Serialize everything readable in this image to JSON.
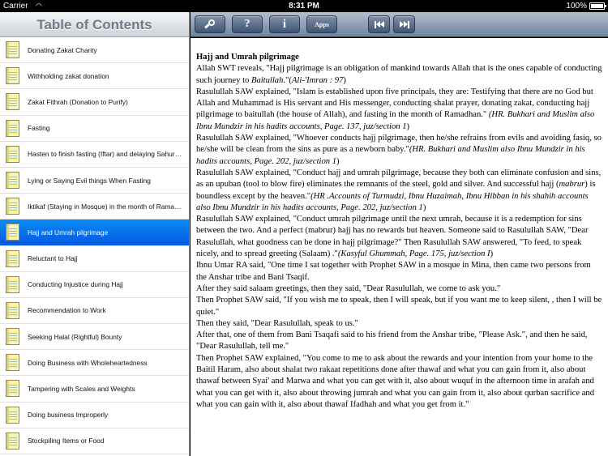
{
  "status_bar": {
    "carrier": "Carrier",
    "time": "8:31 PM",
    "battery": "100%"
  },
  "sidebar": {
    "title": "Table of Contents",
    "items": [
      {
        "label": "Donating Zakat Charity",
        "selected": false
      },
      {
        "label": "Withholding zakat donation",
        "selected": false
      },
      {
        "label": "Zakat Fithrah (Donation to Purify)",
        "selected": false
      },
      {
        "label": "Fasting",
        "selected": false
      },
      {
        "label": "Hasten to finish fasting (Iftar) and delaying Sahur (e...",
        "selected": false
      },
      {
        "label": "Lying or Saying Evil things When Fasting",
        "selected": false
      },
      {
        "label": "Iktikaf (Staying in Mosque) in the month of Ramadh...",
        "selected": false
      },
      {
        "label": "Hajj and Umrah pilgrimage",
        "selected": true
      },
      {
        "label": "Reluctant to Hajj",
        "selected": false
      },
      {
        "label": "Conducting Injustice during Hajj",
        "selected": false
      },
      {
        "label": "Recommendation to Work",
        "selected": false
      },
      {
        "label": "Seeking Halal (Rightful) Bounty",
        "selected": false
      },
      {
        "label": "Doing Business with Wholeheartedness",
        "selected": false
      },
      {
        "label": "Tampering with Scales and Weights",
        "selected": false
      },
      {
        "label": "Doing business Improperly",
        "selected": false
      },
      {
        "label": "Stockpiling Items or Food",
        "selected": false
      }
    ]
  },
  "toolbar": {
    "search_icon": "magnifier-icon",
    "help_label": "?",
    "info_label": "i",
    "apps_label": "Apps",
    "prev_icon": "skip-back-icon",
    "next_icon": "skip-forward-icon"
  },
  "content": {
    "title": "Hajj and Umrah pilgrimage",
    "paragraphs": [
      [
        {
          "t": "Allah SWT reveals, \"Hajj pilgrimage is an obligation of mankind towards Allah that is the ones capable of conducting such journey to "
        },
        {
          "t": "Baitullah",
          "i": true
        },
        {
          "t": ".\"("
        },
        {
          "t": "Ali-'Imran : 97",
          "i": true
        },
        {
          "t": ")"
        }
      ],
      [
        {
          "t": "Rasulullah SAW explained, \"Islam is established upon five principals, they are: Testifying that there are no God but Allah and Muhammad is His servant and  His messenger, conducting shalat prayer, donating zakat, conducting hajj pilgrimage to baitullah (the house of Allah), and fasting in the month of Ramadhan.\" "
        },
        {
          "t": "(HR. Bukhari and Muslim also Ibnu Mundzir in his hadits accounts, Page. 137, juz/section 1",
          "i": true
        },
        {
          "t": ")"
        }
      ],
      [
        {
          "t": "Rasulullah SAW explained, \"Whoever conducts hajj pilgrimage, then he/she refrains from evils and avoiding fasiq, so he/she will be clean from the sins as pure as a newborn baby.\""
        },
        {
          "t": "(HR. Bukhari and Muslim also Ibnu Mundzir in his hadits accounts, Page. 202, juz/section 1",
          "i": true
        },
        {
          "t": ")"
        }
      ],
      [
        {
          "t": "Rasulullah SAW explained, \"Conduct hajj and umrah pilgrimage, because they both can eliminate confusion and sins, as an upuban (tool to blow fire) eliminates the remnants of the steel, gold and silver. And successful hajj ("
        },
        {
          "t": "mabrur",
          "i": true
        },
        {
          "t": ") is boundless except by the heaven.\""
        },
        {
          "t": "(HR .Accounts of  Turmudzi, Ibnu Huzaimah, Ibnu Hibban in his shahih accounts also Ibnu Mundzir in his hadits accounts, Page. 202, juz/section 1",
          "i": true
        },
        {
          "t": ")"
        }
      ],
      [
        {
          "t": "Rasulullah SAW explained, \"Conduct umrah pilgrimage until the next umrah, because it is a redemption for sins between the two. And a perfect (mabrur) hajj has no rewards but heaven. Someone said to Rasulullah SAW, \"Dear Rasulullah, what goodness can be done in hajj pilgrimage?\" Then Rasulullah SAW answered, \"To feed, to speak nicely, and to spread greeting (Salaam) .\""
        },
        {
          "t": "(Kasyful Ghummah, Page. 175, juz/section I",
          "i": true
        },
        {
          "t": ")"
        }
      ],
      [
        {
          "t": " Ibnu Umar RA said, \"One time I sat together with Prophet SAW in a mosque in Mina, then came two persons from the Anshar tribe and Bani Tsaqif."
        }
      ],
      [
        {
          "t": "After they said salaam greetings, then they said, \"Dear Rasulullah, we come to ask you.\""
        }
      ],
      [
        {
          "t": "Then Prophet SAW said, \"If you wish me to speak, then I will speak, but if you want me to keep silent, , then I will be quiet.\""
        }
      ],
      [
        {
          "t": "Then they said, \"Dear Rasulullah, speak to us.\""
        }
      ],
      [
        {
          "t": "After that, one of them from Bani Tsaqafi said to his friend from the Anshar tribe, \"Please Ask.\", and then he said, \"Dear Rasulullah, tell me.\""
        }
      ],
      [
        {
          "t": "Then Prophet SAW explained, \"You come to me to ask about the rewards and your intention from your home to the Baitil Haram, also about shalat two rakaat repetitions done after thawaf and what you can gain from it, also about thawaf between Syai' and Marwa and what you can get with it, also about wuquf in the afternoon time in arafah and what you can get with it, also about throwing jumrah and what you can gain from it, also about qurban sacrifice and what you can gain with it, also about thawaf Ifadhah and what you get from it.\""
        }
      ]
    ]
  }
}
